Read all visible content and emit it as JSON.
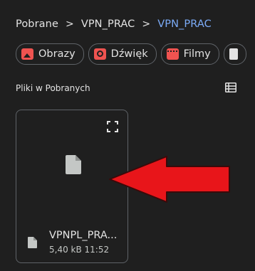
{
  "breadcrumb": {
    "items": [
      {
        "label": "Pobrane"
      },
      {
        "label": "VPN_PRAC"
      },
      {
        "label": "VPN_PRAC"
      }
    ],
    "separator": ">"
  },
  "filters": {
    "chips": [
      {
        "label": "Obrazy",
        "icon": "image-icon"
      },
      {
        "label": "Dźwięk",
        "icon": "audio-icon"
      },
      {
        "label": "Filmy",
        "icon": "video-icon"
      },
      {
        "label": "",
        "icon": "document-icon"
      }
    ]
  },
  "section": {
    "title": "Pliki w Pobranych",
    "view_toggle_icon": "list-view-icon"
  },
  "files": [
    {
      "name": "VPNPL_PRA...",
      "meta": "5,40 kB 11:52",
      "thumbnail_icon": "file-icon",
      "expand_icon": "fullscreen-icon"
    }
  ],
  "colors": {
    "background": "#1f1f1f",
    "text": "#e3e3e3",
    "link": "#7cacf8",
    "chip_accent": "#ef5350",
    "annotation_arrow": "#e8151a"
  }
}
